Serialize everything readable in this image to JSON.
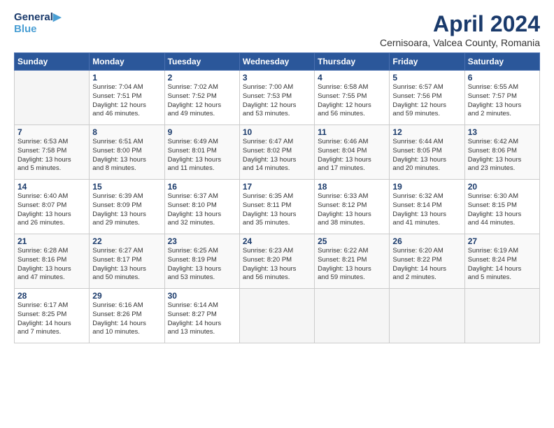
{
  "header": {
    "title": "April 2024",
    "location": "Cernisoara, Valcea County, Romania"
  },
  "days": [
    "Sunday",
    "Monday",
    "Tuesday",
    "Wednesday",
    "Thursday",
    "Friday",
    "Saturday"
  ],
  "weeks": [
    [
      {
        "day": "",
        "detail": ""
      },
      {
        "day": "1",
        "detail": "Sunrise: 7:04 AM\nSunset: 7:51 PM\nDaylight: 12 hours\nand 46 minutes."
      },
      {
        "day": "2",
        "detail": "Sunrise: 7:02 AM\nSunset: 7:52 PM\nDaylight: 12 hours\nand 49 minutes."
      },
      {
        "day": "3",
        "detail": "Sunrise: 7:00 AM\nSunset: 7:53 PM\nDaylight: 12 hours\nand 53 minutes."
      },
      {
        "day": "4",
        "detail": "Sunrise: 6:58 AM\nSunset: 7:55 PM\nDaylight: 12 hours\nand 56 minutes."
      },
      {
        "day": "5",
        "detail": "Sunrise: 6:57 AM\nSunset: 7:56 PM\nDaylight: 12 hours\nand 59 minutes."
      },
      {
        "day": "6",
        "detail": "Sunrise: 6:55 AM\nSunset: 7:57 PM\nDaylight: 13 hours\nand 2 minutes."
      }
    ],
    [
      {
        "day": "7",
        "detail": "Sunrise: 6:53 AM\nSunset: 7:58 PM\nDaylight: 13 hours\nand 5 minutes."
      },
      {
        "day": "8",
        "detail": "Sunrise: 6:51 AM\nSunset: 8:00 PM\nDaylight: 13 hours\nand 8 minutes."
      },
      {
        "day": "9",
        "detail": "Sunrise: 6:49 AM\nSunset: 8:01 PM\nDaylight: 13 hours\nand 11 minutes."
      },
      {
        "day": "10",
        "detail": "Sunrise: 6:47 AM\nSunset: 8:02 PM\nDaylight: 13 hours\nand 14 minutes."
      },
      {
        "day": "11",
        "detail": "Sunrise: 6:46 AM\nSunset: 8:04 PM\nDaylight: 13 hours\nand 17 minutes."
      },
      {
        "day": "12",
        "detail": "Sunrise: 6:44 AM\nSunset: 8:05 PM\nDaylight: 13 hours\nand 20 minutes."
      },
      {
        "day": "13",
        "detail": "Sunrise: 6:42 AM\nSunset: 8:06 PM\nDaylight: 13 hours\nand 23 minutes."
      }
    ],
    [
      {
        "day": "14",
        "detail": "Sunrise: 6:40 AM\nSunset: 8:07 PM\nDaylight: 13 hours\nand 26 minutes."
      },
      {
        "day": "15",
        "detail": "Sunrise: 6:39 AM\nSunset: 8:09 PM\nDaylight: 13 hours\nand 29 minutes."
      },
      {
        "day": "16",
        "detail": "Sunrise: 6:37 AM\nSunset: 8:10 PM\nDaylight: 13 hours\nand 32 minutes."
      },
      {
        "day": "17",
        "detail": "Sunrise: 6:35 AM\nSunset: 8:11 PM\nDaylight: 13 hours\nand 35 minutes."
      },
      {
        "day": "18",
        "detail": "Sunrise: 6:33 AM\nSunset: 8:12 PM\nDaylight: 13 hours\nand 38 minutes."
      },
      {
        "day": "19",
        "detail": "Sunrise: 6:32 AM\nSunset: 8:14 PM\nDaylight: 13 hours\nand 41 minutes."
      },
      {
        "day": "20",
        "detail": "Sunrise: 6:30 AM\nSunset: 8:15 PM\nDaylight: 13 hours\nand 44 minutes."
      }
    ],
    [
      {
        "day": "21",
        "detail": "Sunrise: 6:28 AM\nSunset: 8:16 PM\nDaylight: 13 hours\nand 47 minutes."
      },
      {
        "day": "22",
        "detail": "Sunrise: 6:27 AM\nSunset: 8:17 PM\nDaylight: 13 hours\nand 50 minutes."
      },
      {
        "day": "23",
        "detail": "Sunrise: 6:25 AM\nSunset: 8:19 PM\nDaylight: 13 hours\nand 53 minutes."
      },
      {
        "day": "24",
        "detail": "Sunrise: 6:23 AM\nSunset: 8:20 PM\nDaylight: 13 hours\nand 56 minutes."
      },
      {
        "day": "25",
        "detail": "Sunrise: 6:22 AM\nSunset: 8:21 PM\nDaylight: 13 hours\nand 59 minutes."
      },
      {
        "day": "26",
        "detail": "Sunrise: 6:20 AM\nSunset: 8:22 PM\nDaylight: 14 hours\nand 2 minutes."
      },
      {
        "day": "27",
        "detail": "Sunrise: 6:19 AM\nSunset: 8:24 PM\nDaylight: 14 hours\nand 5 minutes."
      }
    ],
    [
      {
        "day": "28",
        "detail": "Sunrise: 6:17 AM\nSunset: 8:25 PM\nDaylight: 14 hours\nand 7 minutes."
      },
      {
        "day": "29",
        "detail": "Sunrise: 6:16 AM\nSunset: 8:26 PM\nDaylight: 14 hours\nand 10 minutes."
      },
      {
        "day": "30",
        "detail": "Sunrise: 6:14 AM\nSunset: 8:27 PM\nDaylight: 14 hours\nand 13 minutes."
      },
      {
        "day": "",
        "detail": ""
      },
      {
        "day": "",
        "detail": ""
      },
      {
        "day": "",
        "detail": ""
      },
      {
        "day": "",
        "detail": ""
      }
    ]
  ]
}
